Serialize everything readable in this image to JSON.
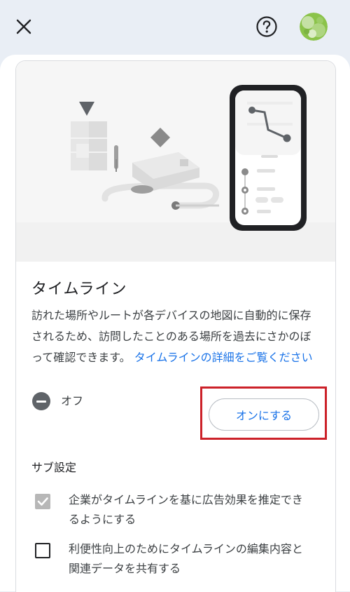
{
  "header": {
    "close_icon": "close-icon",
    "help_icon": "help-circle-icon",
    "avatar_icon": "account-avatar"
  },
  "timeline": {
    "title": "タイムライン",
    "description": "訪れた場所やルートが各デバイスの地図に自動的に保存されるため、訪問したことのある場所を過去にさかのぼって確認できます。",
    "link": "タイムラインの詳細をご覧ください",
    "status": "オフ",
    "turn_on_label": "オンにする"
  },
  "sub_settings": {
    "title": "サブ設定",
    "items": [
      {
        "label": "企業がタイムラインを基に広告効果を推定できるようにする",
        "checked": true,
        "disabled": true
      },
      {
        "label": "利便性向上のためにタイムラインの編集内容と関連データを共有する",
        "checked": false,
        "disabled": false
      }
    ]
  },
  "colors": {
    "accent": "#1a73e8",
    "highlight": "#cc2129",
    "background": "#e9eef5"
  }
}
